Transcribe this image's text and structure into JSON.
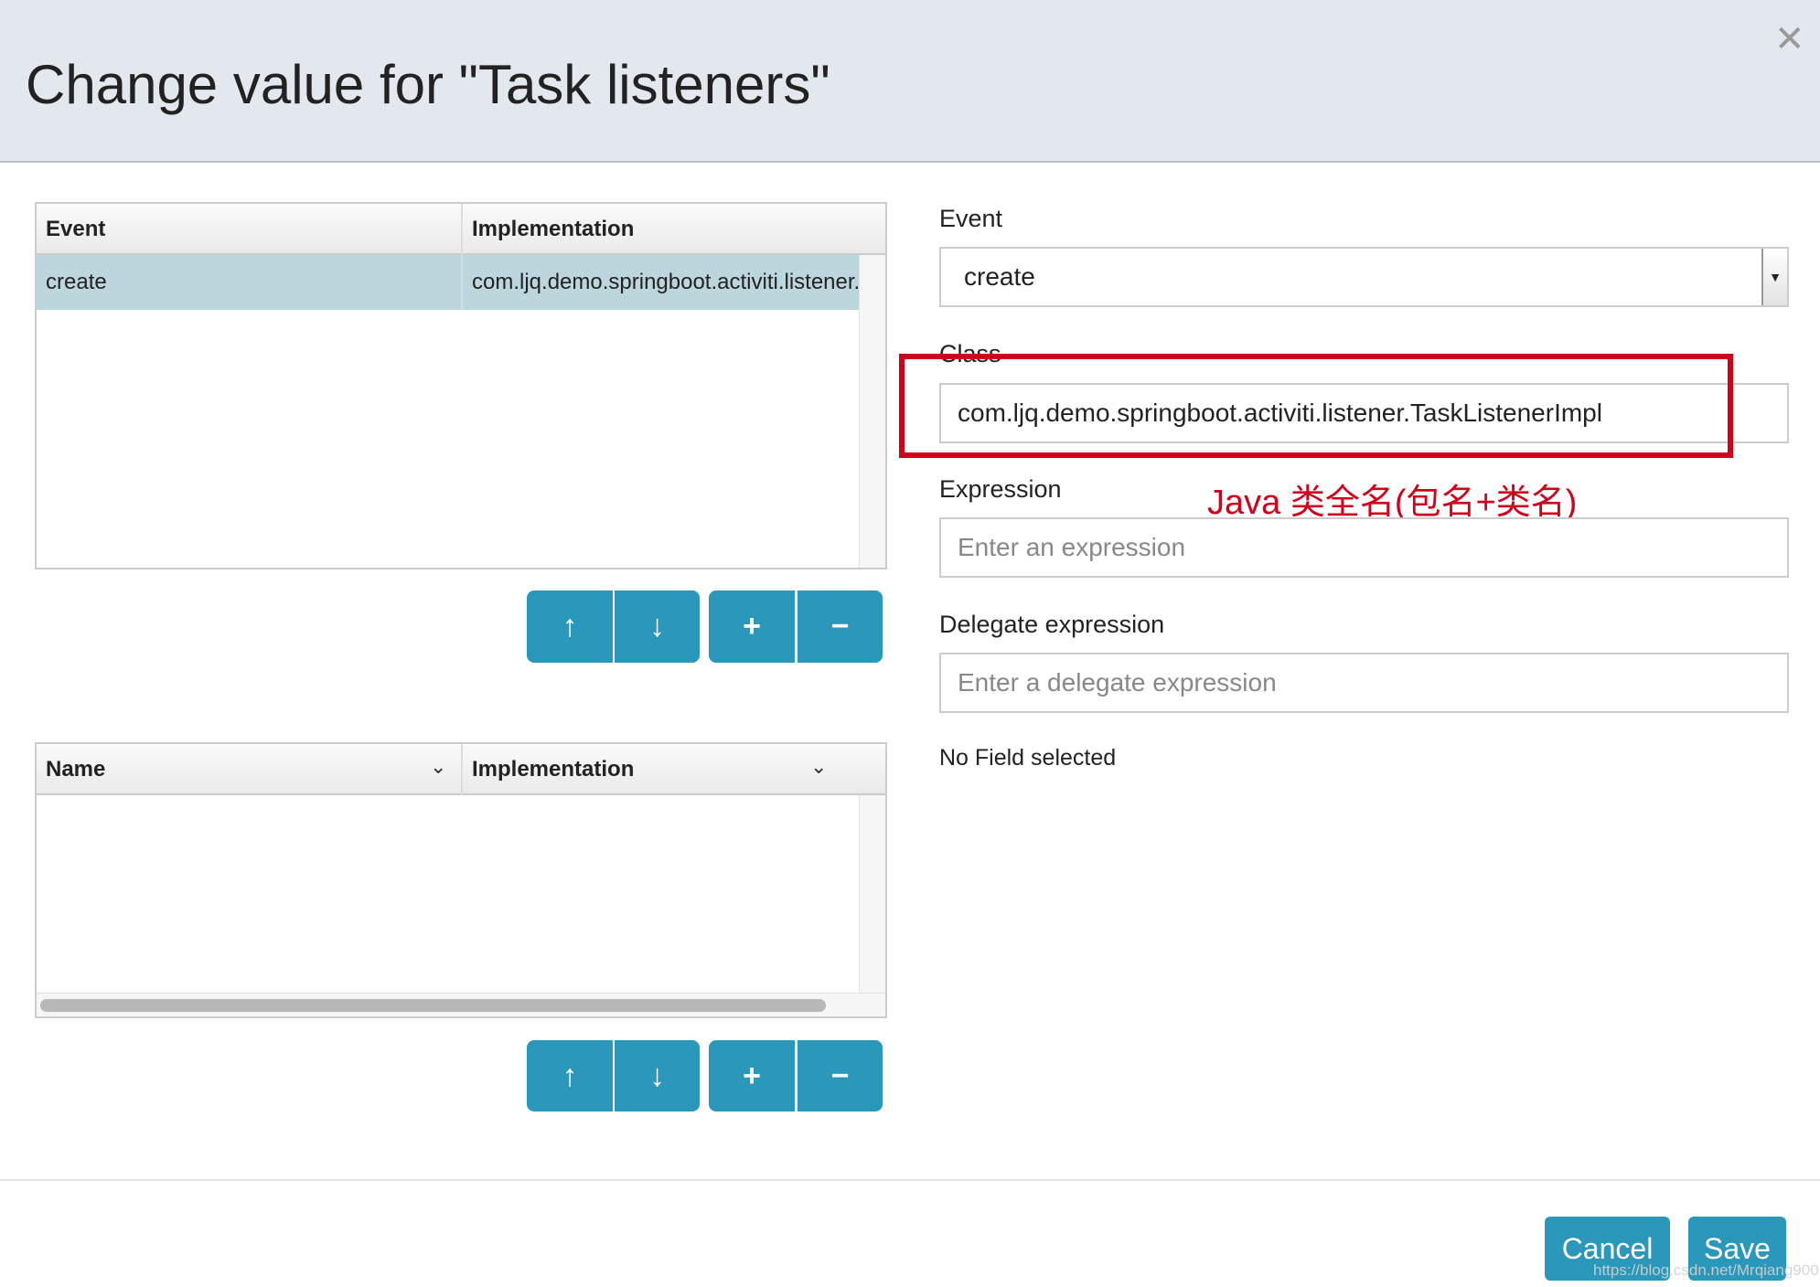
{
  "dialog": {
    "title": "Change value for \"Task listeners\"",
    "close_icon": "close-icon"
  },
  "listeners_table": {
    "columns": [
      "Event",
      "Implementation"
    ],
    "rows": [
      {
        "event": "create",
        "implementation": "com.ljq.demo.springboot.activiti.listener."
      }
    ]
  },
  "fields_table": {
    "columns": [
      "Name",
      "Implementation"
    ],
    "rows": []
  },
  "toolbar": {
    "up": "↑",
    "down": "↓",
    "add": "+",
    "remove": "−"
  },
  "form": {
    "event_label": "Event",
    "event_value": "create",
    "class_label": "Class",
    "class_value": "com.ljq.demo.springboot.activiti.listener.TaskListenerImpl",
    "expression_label": "Expression",
    "expression_placeholder": "Enter an expression",
    "delegate_label": "Delegate expression",
    "delegate_placeholder": "Enter a delegate expression",
    "no_field": "No Field selected"
  },
  "annotation": {
    "text": "Java 类全名(包名+类名)",
    "color": "#d0021b"
  },
  "footer": {
    "cancel": "Cancel",
    "save": "Save"
  },
  "watermark": "https://blog.csdn.net/Mrqiang9001",
  "colors": {
    "accent": "#2a97bb",
    "selected_row": "#bdd5dc",
    "header_bg": "#e3e8ef"
  }
}
